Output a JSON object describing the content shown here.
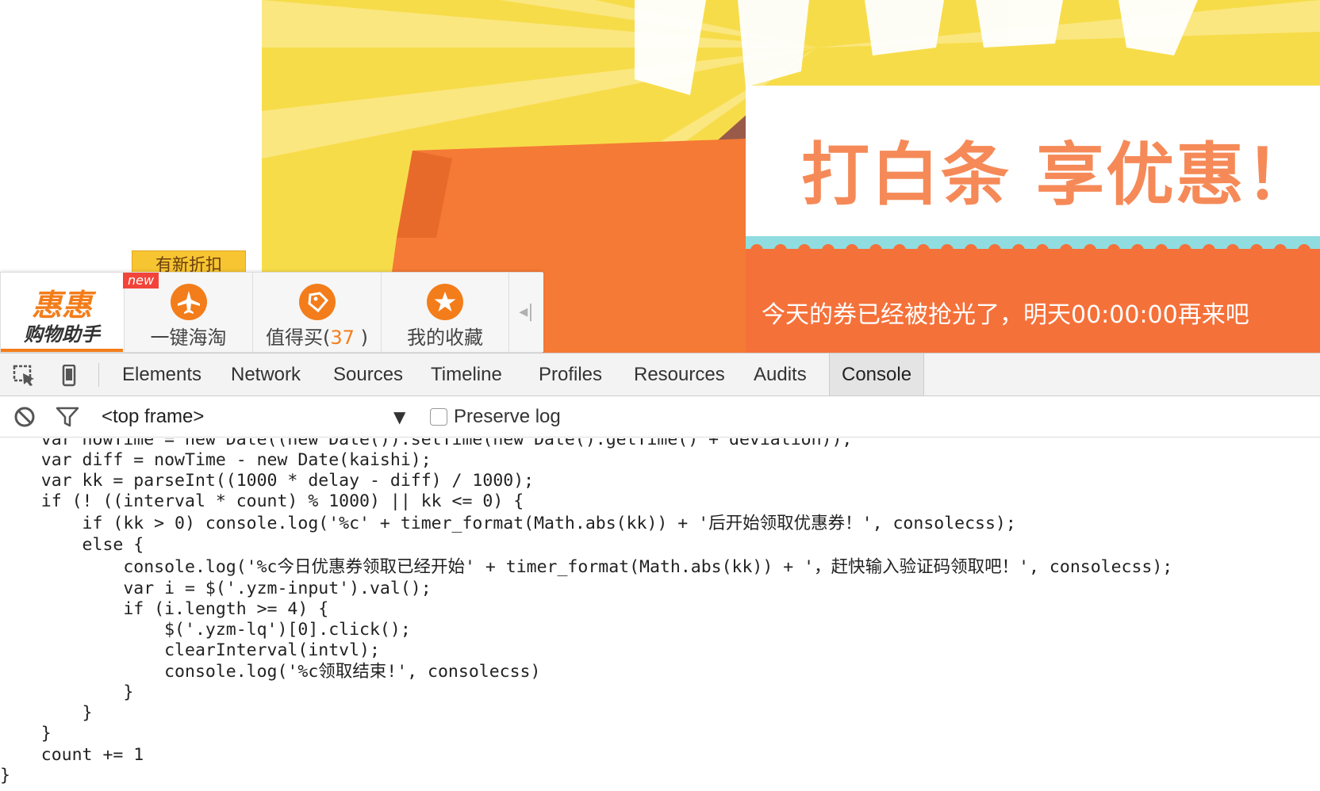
{
  "webpage": {
    "banner": {
      "headline": "打白条 享优惠！",
      "message": "今天的券已经被抢光了，明天00:00:00再来吧"
    }
  },
  "assistant": {
    "tooltip": "有新折扣",
    "brand_top": "惠惠",
    "brand_bottom": "购物助手",
    "new_badge": "new",
    "tools": [
      {
        "label": "一键海淘",
        "icon": "airplane-icon"
      },
      {
        "label": "值得买(",
        "count": "37",
        "suffix": ")",
        "icon": "tag-icon"
      },
      {
        "label": "我的收藏",
        "icon": "star-icon"
      }
    ],
    "collapse_icon": "collapse-arrow-icon"
  },
  "devtools": {
    "tabs": [
      "Elements",
      "Network",
      "Sources",
      "Timeline",
      "Profiles",
      "Resources",
      "Audits",
      "Console"
    ],
    "active_tab": "Console",
    "frame_select": "<top frame>",
    "preserve_log": "Preserve log",
    "console_lines": [
      "    var nowTime = new Date((new Date()).setTime(new Date().getTime() + deviation));",
      "    var diff = nowTime - new Date(kaishi);",
      "    var kk = parseInt((1000 * delay - diff) / 1000);",
      "    if (! ((interval * count) % 1000) || kk <= 0) {",
      "        if (kk > 0) console.log('%c' + timer_format(Math.abs(kk)) + '后开始领取优惠券！', consolecss);",
      "        else {",
      "            console.log('%c今日优惠券领取已经开始' + timer_format(Math.abs(kk)) + '，赶快输入验证码领取吧！', consolecss);",
      "            var i = $('.yzm-input').val();",
      "            if (i.length >= 4) {",
      "                $('.yzm-lq')[0].click();",
      "                clearInterval(intvl);",
      "                console.log('%c领取结束!', consolecss)",
      "            }",
      "        }",
      "    }",
      "    count += 1",
      "}"
    ]
  },
  "colors": {
    "brand_orange": "#f37d1a",
    "banner_yellow": "#f7dc4a",
    "banner_orange": "#f5713a",
    "banner_teal": "#8fdde0",
    "devtools_toolbar": "#f3f3f3"
  }
}
